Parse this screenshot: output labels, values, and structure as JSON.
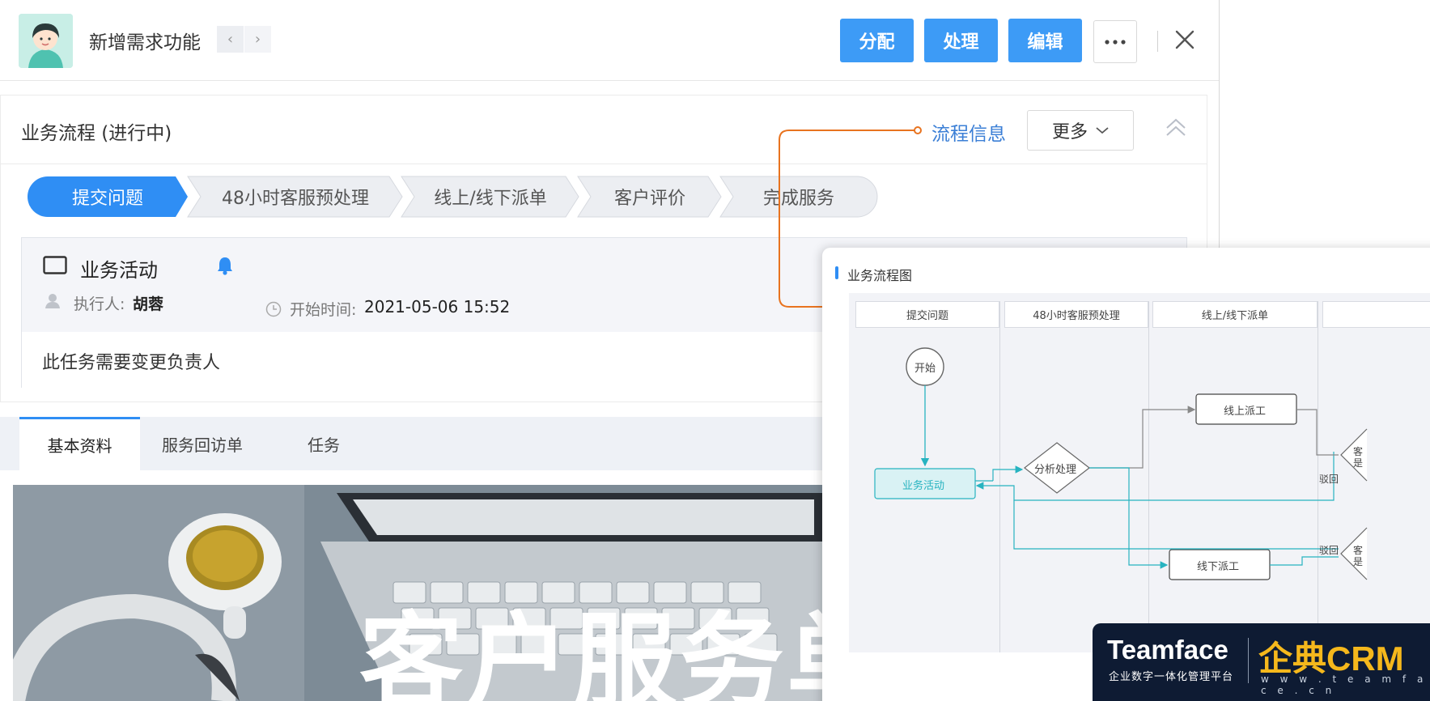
{
  "header": {
    "title": "新增需求功能",
    "prev_icon": "chevron-left-icon",
    "next_icon": "chevron-right-icon",
    "buttons": {
      "assign": "分配",
      "process": "处理",
      "edit": "编辑"
    },
    "accent_color": "#3d9bf6"
  },
  "process": {
    "title": "业务流程 (进行中)",
    "flow_info_link": "流程信息",
    "more_dropdown": "更多",
    "stages": [
      {
        "label": "提交问题",
        "active": true
      },
      {
        "label": "48小时客服预处理",
        "active": false
      },
      {
        "label": "线上/线下派单",
        "active": false
      },
      {
        "label": "客户评价",
        "active": false
      },
      {
        "label": "完成服务",
        "active": false
      }
    ]
  },
  "activity": {
    "title": "业务活动",
    "executor_label": "执行人:",
    "executor_name": "胡蓉",
    "start_label": "开始时间:",
    "start_value": "2021-05-06 15:52",
    "description": "此任务需要变更负责人"
  },
  "tabs": [
    "基本资料",
    "服务回访单",
    "任务"
  ],
  "banner": {
    "title": "客户服务单"
  },
  "flow_panel": {
    "title": "业务流程图",
    "lanes": [
      "提交问题",
      "48小时客服预处理",
      "线上/线下派单"
    ],
    "nodes": {
      "start": "开始",
      "activity": "业务活动",
      "analyze": "分析处理",
      "online": "线上派工",
      "offline": "线下派工",
      "reject_1": "驳回",
      "reject_2": "驳回",
      "partial_1": "客",
      "partial_1b": "是",
      "partial_2": "客",
      "partial_2b": "是"
    }
  },
  "badge": {
    "name": "Teamface",
    "subtitle": "企业数字一体化管理平台",
    "brand": "企典CRM",
    "url": "w w w . t e a m f a c e . c n"
  }
}
